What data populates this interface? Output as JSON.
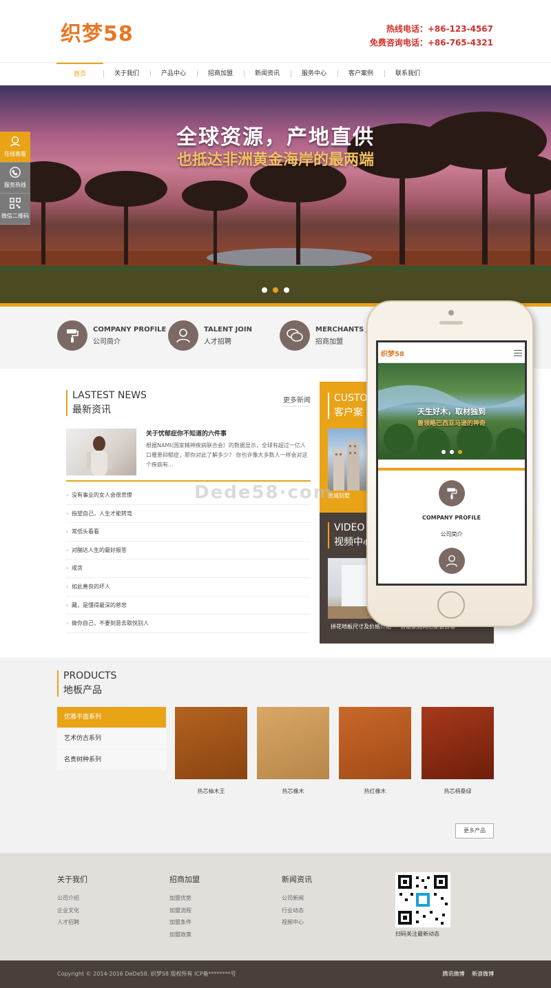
{
  "header": {
    "logo": "织梦58",
    "hotline": "热线电话：+86-123-4567",
    "freeline": "免费咨询电话：+86-765-4321"
  },
  "nav": [
    "首页",
    "关于我们",
    "产品中心",
    "招商加盟",
    "新闻资讯",
    "服务中心",
    "客户案例",
    "联系我们"
  ],
  "banner": {
    "title": "全球资源，产地直供",
    "subtitle": "也抵达非洲黄金海岸的最两端"
  },
  "side": [
    "在线客服",
    "服务热线",
    "微信二维码"
  ],
  "strip": [
    {
      "en": "COMPANY PROFILE",
      "cn": "公司简介"
    },
    {
      "en": "TALENT JOIN",
      "cn": "人才招聘"
    },
    {
      "en": "MERCHANTS JO",
      "cn": "招商加盟"
    }
  ],
  "news": {
    "en": "LASTEST NEWS",
    "cn": "最新资讯",
    "more": "更多新闻",
    "feature_title": "关于忧郁症你不知道的六件事",
    "feature_desc": "根据NAMI(国家精神疾病联合会）的数据显示，全球有超过一亿人口罹患抑郁症，那你对此了解多少？ 你也许像大多数人一样会对这个疾病有...",
    "list": [
      "没有事业的女人会很悲惨",
      "指望自己，人生才能转弯",
      "常低头看看",
      "对酗达人生的最好报答",
      "戒贪",
      "如此善良的坏人",
      "藏，是懂得最深的慈悲",
      "做你自己，不要刻意去取悦别人"
    ]
  },
  "cases": {
    "en": "CUSTO",
    "cn": "客户案",
    "label": "金城别墅"
  },
  "video": {
    "en": "VIDEO",
    "cn": "视频中心",
    "caption": "拼花地板尺寸及价格介绍 — 智能家居网络家装去哪"
  },
  "watermark": "Dede58·com",
  "mobile": {
    "logo": "织梦58",
    "title": "天生好木，取材独到",
    "subtitle": "曾领略巴西亚马逊的神奇",
    "en": "COMPANY PROFILE",
    "cn": "公司简介"
  },
  "products": {
    "en": "PRODUCTS",
    "cn": "地板产品",
    "categories": [
      "优雅平面系列",
      "艺术仿古系列",
      "名贵树种系列"
    ],
    "items": [
      {
        "name": "热芯柚木王",
        "color1": "#b3631f",
        "color2": "#8a4412"
      },
      {
        "name": "热芯橡木",
        "color1": "#d9a866",
        "color2": "#b6864a"
      },
      {
        "name": "热红橡木",
        "color1": "#c9682a",
        "color2": "#a14a18"
      },
      {
        "name": "热芯柄桑绿",
        "color1": "#a7391a",
        "color2": "#6e1e0b"
      }
    ],
    "more": "更多产品"
  },
  "footer": {
    "cols": [
      {
        "title": "关于我们",
        "items": [
          "公司介绍",
          "企业文化",
          "人才招聘"
        ]
      },
      {
        "title": "招商加盟",
        "items": [
          "加盟优势",
          "加盟流程",
          "加盟条件",
          "加盟政策"
        ]
      },
      {
        "title": "新闻资讯",
        "items": [
          "公司新闻",
          "行业动态",
          "视频中心"
        ]
      }
    ],
    "qr_text": "扫码关注最新动态",
    "copyright": "Copyright © 2014-2016 DeDe58. 织梦58 版权所有  ICP备********号",
    "weibo_tencent": "腾讯微博",
    "weibo_sina": "新浪微博"
  },
  "colors": {
    "accent": "#e8a317",
    "logo": "#e87722",
    "contact": "#d0302b",
    "dark": "#4a403b"
  }
}
